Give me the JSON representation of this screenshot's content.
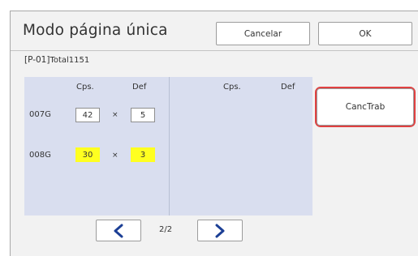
{
  "dialog": {
    "title": "Modo página única",
    "cancel_label": "Cancelar",
    "ok_label": "OK"
  },
  "job": {
    "code": "[P-01]",
    "total": "Total1151"
  },
  "table": {
    "left_headers": {
      "copies": "Cps.",
      "sets": "Def"
    },
    "right_headers": {
      "copies": "Cps.",
      "sets": "Def"
    },
    "rows": [
      {
        "label": "007G",
        "copies": "42",
        "sets": "5",
        "highlighted": false
      },
      {
        "label": "008G",
        "copies": "30",
        "sets": "3",
        "highlighted": true
      }
    ],
    "times_symbol": "×"
  },
  "actions": {
    "cancel_job_label": "CancTrab"
  },
  "pagination": {
    "page": "2/2"
  },
  "colors": {
    "panel": "#d9deef",
    "highlight": "#ffff20",
    "focus_ring": "#e04040",
    "nav_arrow": "#1c3f95"
  }
}
